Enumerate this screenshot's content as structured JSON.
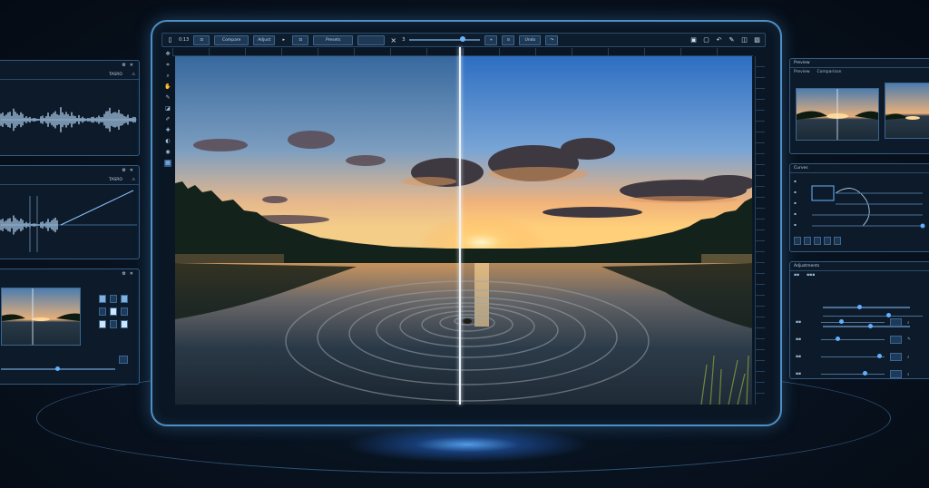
{
  "toolbar": {
    "zoom_label": "0:13",
    "before_after_label": "Compare",
    "adjust_label": "Adjust",
    "presets_label": "Presets",
    "close_glyph": "×",
    "step_value": "3",
    "undo_label": "Undo"
  },
  "left_panels": [
    {
      "title": "TASRO"
    },
    {
      "title": "TASRO"
    }
  ],
  "right_panels": {
    "preview_title": "Preview",
    "preview_tabs": [
      "Preview",
      "Comparison"
    ],
    "curves_title": "Curves",
    "adjust_title": "Adjustments"
  },
  "colors": {
    "accent": "#4e8fc4",
    "knob": "#6ab4ff",
    "waveform": "#bfe0ff",
    "divider": "#e9f3ff"
  }
}
